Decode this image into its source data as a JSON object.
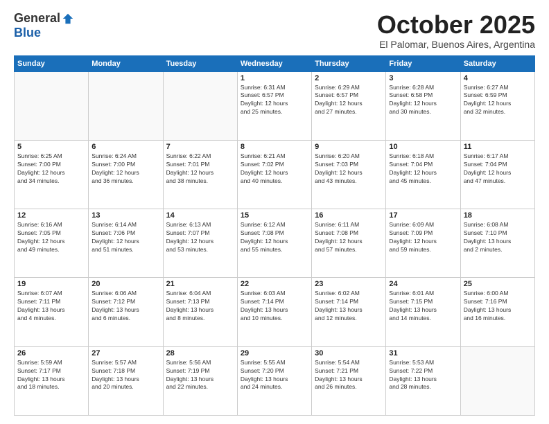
{
  "logo": {
    "general": "General",
    "blue": "Blue"
  },
  "header": {
    "month": "October 2025",
    "location": "El Palomar, Buenos Aires, Argentina"
  },
  "weekdays": [
    "Sunday",
    "Monday",
    "Tuesday",
    "Wednesday",
    "Thursday",
    "Friday",
    "Saturday"
  ],
  "weeks": [
    [
      {
        "day": "",
        "info": ""
      },
      {
        "day": "",
        "info": ""
      },
      {
        "day": "",
        "info": ""
      },
      {
        "day": "1",
        "info": "Sunrise: 6:31 AM\nSunset: 6:57 PM\nDaylight: 12 hours\nand 25 minutes."
      },
      {
        "day": "2",
        "info": "Sunrise: 6:29 AM\nSunset: 6:57 PM\nDaylight: 12 hours\nand 27 minutes."
      },
      {
        "day": "3",
        "info": "Sunrise: 6:28 AM\nSunset: 6:58 PM\nDaylight: 12 hours\nand 30 minutes."
      },
      {
        "day": "4",
        "info": "Sunrise: 6:27 AM\nSunset: 6:59 PM\nDaylight: 12 hours\nand 32 minutes."
      }
    ],
    [
      {
        "day": "5",
        "info": "Sunrise: 6:25 AM\nSunset: 7:00 PM\nDaylight: 12 hours\nand 34 minutes."
      },
      {
        "day": "6",
        "info": "Sunrise: 6:24 AM\nSunset: 7:00 PM\nDaylight: 12 hours\nand 36 minutes."
      },
      {
        "day": "7",
        "info": "Sunrise: 6:22 AM\nSunset: 7:01 PM\nDaylight: 12 hours\nand 38 minutes."
      },
      {
        "day": "8",
        "info": "Sunrise: 6:21 AM\nSunset: 7:02 PM\nDaylight: 12 hours\nand 40 minutes."
      },
      {
        "day": "9",
        "info": "Sunrise: 6:20 AM\nSunset: 7:03 PM\nDaylight: 12 hours\nand 43 minutes."
      },
      {
        "day": "10",
        "info": "Sunrise: 6:18 AM\nSunset: 7:04 PM\nDaylight: 12 hours\nand 45 minutes."
      },
      {
        "day": "11",
        "info": "Sunrise: 6:17 AM\nSunset: 7:04 PM\nDaylight: 12 hours\nand 47 minutes."
      }
    ],
    [
      {
        "day": "12",
        "info": "Sunrise: 6:16 AM\nSunset: 7:05 PM\nDaylight: 12 hours\nand 49 minutes."
      },
      {
        "day": "13",
        "info": "Sunrise: 6:14 AM\nSunset: 7:06 PM\nDaylight: 12 hours\nand 51 minutes."
      },
      {
        "day": "14",
        "info": "Sunrise: 6:13 AM\nSunset: 7:07 PM\nDaylight: 12 hours\nand 53 minutes."
      },
      {
        "day": "15",
        "info": "Sunrise: 6:12 AM\nSunset: 7:08 PM\nDaylight: 12 hours\nand 55 minutes."
      },
      {
        "day": "16",
        "info": "Sunrise: 6:11 AM\nSunset: 7:08 PM\nDaylight: 12 hours\nand 57 minutes."
      },
      {
        "day": "17",
        "info": "Sunrise: 6:09 AM\nSunset: 7:09 PM\nDaylight: 12 hours\nand 59 minutes."
      },
      {
        "day": "18",
        "info": "Sunrise: 6:08 AM\nSunset: 7:10 PM\nDaylight: 13 hours\nand 2 minutes."
      }
    ],
    [
      {
        "day": "19",
        "info": "Sunrise: 6:07 AM\nSunset: 7:11 PM\nDaylight: 13 hours\nand 4 minutes."
      },
      {
        "day": "20",
        "info": "Sunrise: 6:06 AM\nSunset: 7:12 PM\nDaylight: 13 hours\nand 6 minutes."
      },
      {
        "day": "21",
        "info": "Sunrise: 6:04 AM\nSunset: 7:13 PM\nDaylight: 13 hours\nand 8 minutes."
      },
      {
        "day": "22",
        "info": "Sunrise: 6:03 AM\nSunset: 7:14 PM\nDaylight: 13 hours\nand 10 minutes."
      },
      {
        "day": "23",
        "info": "Sunrise: 6:02 AM\nSunset: 7:14 PM\nDaylight: 13 hours\nand 12 minutes."
      },
      {
        "day": "24",
        "info": "Sunrise: 6:01 AM\nSunset: 7:15 PM\nDaylight: 13 hours\nand 14 minutes."
      },
      {
        "day": "25",
        "info": "Sunrise: 6:00 AM\nSunset: 7:16 PM\nDaylight: 13 hours\nand 16 minutes."
      }
    ],
    [
      {
        "day": "26",
        "info": "Sunrise: 5:59 AM\nSunset: 7:17 PM\nDaylight: 13 hours\nand 18 minutes."
      },
      {
        "day": "27",
        "info": "Sunrise: 5:57 AM\nSunset: 7:18 PM\nDaylight: 13 hours\nand 20 minutes."
      },
      {
        "day": "28",
        "info": "Sunrise: 5:56 AM\nSunset: 7:19 PM\nDaylight: 13 hours\nand 22 minutes."
      },
      {
        "day": "29",
        "info": "Sunrise: 5:55 AM\nSunset: 7:20 PM\nDaylight: 13 hours\nand 24 minutes."
      },
      {
        "day": "30",
        "info": "Sunrise: 5:54 AM\nSunset: 7:21 PM\nDaylight: 13 hours\nand 26 minutes."
      },
      {
        "day": "31",
        "info": "Sunrise: 5:53 AM\nSunset: 7:22 PM\nDaylight: 13 hours\nand 28 minutes."
      },
      {
        "day": "",
        "info": ""
      }
    ]
  ]
}
